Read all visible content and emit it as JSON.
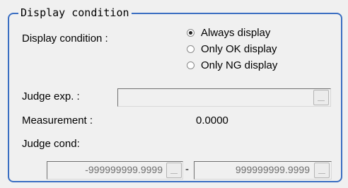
{
  "group_title": "Display condition",
  "display_condition": {
    "label": "Display condition :",
    "options": [
      "Always display",
      "Only OK display",
      "Only NG display"
    ],
    "selected": "Always display"
  },
  "judge_exp": {
    "label": "Judge exp. :",
    "value": ""
  },
  "measurement": {
    "label": "Measurement :",
    "value": "0.0000"
  },
  "judge_cond": {
    "label": "Judge cond:",
    "lower": "-999999999.9999",
    "separator": "-",
    "upper": "999999999.9999"
  }
}
